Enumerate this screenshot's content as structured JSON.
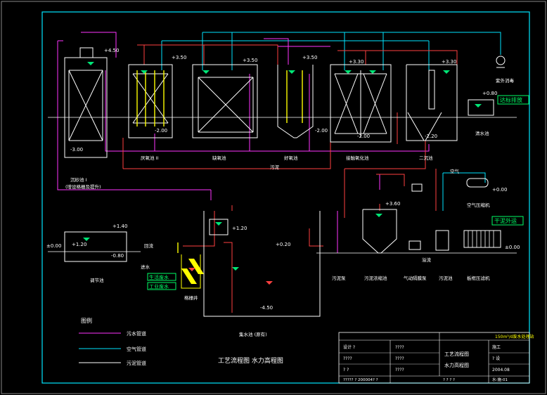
{
  "colors": {
    "frame": "#00e5ff",
    "sewage": "#ff33ff",
    "air": "#00e5ff",
    "sludge": "#ffffff",
    "tank": "#ffffff",
    "water": "#00e676",
    "pipe_red": "#ff4040",
    "yellow": "#ffff00",
    "stamp": "#00ff66"
  },
  "units": {
    "u1": {
      "label": "沉砂池 I",
      "sub": "(增设格栅及提升)",
      "level_top": "+4.50",
      "level_bot": "-3.00"
    },
    "u2": {
      "label": "厌氧池 II",
      "level_top": "+3.50",
      "level_bot": "-2.00"
    },
    "u3": {
      "label": "缺氧池",
      "level_top": "+3.50"
    },
    "u4": {
      "label": "好氧池",
      "level_top": "+3.50",
      "level_bot": "-2.00"
    },
    "u5": {
      "label": "接触氧化池",
      "level_top": "+3.30",
      "level_bot": "-2.00"
    },
    "u6": {
      "label": "二沉池",
      "level_top": "+3.30",
      "level_bot": "-2.20"
    },
    "u7": {
      "label": "清水池",
      "level_top": "+0.80"
    },
    "u8": {
      "label": "紫外消毒",
      "level": "+0.00"
    },
    "u9": {
      "label": "空气压缩机"
    },
    "u10": {
      "label": "调节池",
      "level_top": "+1.40",
      "level_mid": "+1.20",
      "level_bot": "-0.80",
      "level_left": "±0.00"
    },
    "u11": {
      "label": "格栅井"
    },
    "u12": {
      "label": "集水池 (原有)",
      "level_top": "+1.20",
      "level_mid": "+0.20",
      "level_bot": "-4.50"
    },
    "u13": {
      "label": "污泥浓缩池",
      "level_top": "+3.60"
    },
    "u14": {
      "label": "污泥泵"
    },
    "u15": {
      "label": "气动隔膜泵"
    },
    "u16": {
      "label": "污泥池"
    },
    "u17": {
      "label": "板框压滤机",
      "level": "±0.00"
    }
  },
  "stamps": {
    "discharge": "达标排放",
    "sludge_out": "干泥外运",
    "inlet1": "生活废水",
    "inlet2": "工业废水"
  },
  "labels": {
    "return_pipe": "污泥",
    "return_pipe2": "回流",
    "inlet_pipe": "进水",
    "air_text": "空气",
    "drain": "溢流"
  },
  "legend": {
    "title": "图例",
    "items": [
      {
        "name": "污水管道"
      },
      {
        "name": "空气管道"
      },
      {
        "name": "污泥管道"
      }
    ]
  },
  "drawing_title": "工艺流程图  水力高程图",
  "title_block": {
    "header": "150m³/d废水处理站",
    "left_rows": [
      "设计 ?",
      "????",
      "?  ?"
    ],
    "mid_rows": [
      "????",
      "????",
      "????"
    ],
    "name1": "工艺流程图",
    "name2": "水力高程图",
    "right_rows": [
      "施工",
      "?  设",
      "2004.08"
    ],
    "bottom_left": "?????  ?   200004?  ?",
    "bottom_mid": "?  ?  ?  ?",
    "bottom_right": "水-施-01"
  }
}
